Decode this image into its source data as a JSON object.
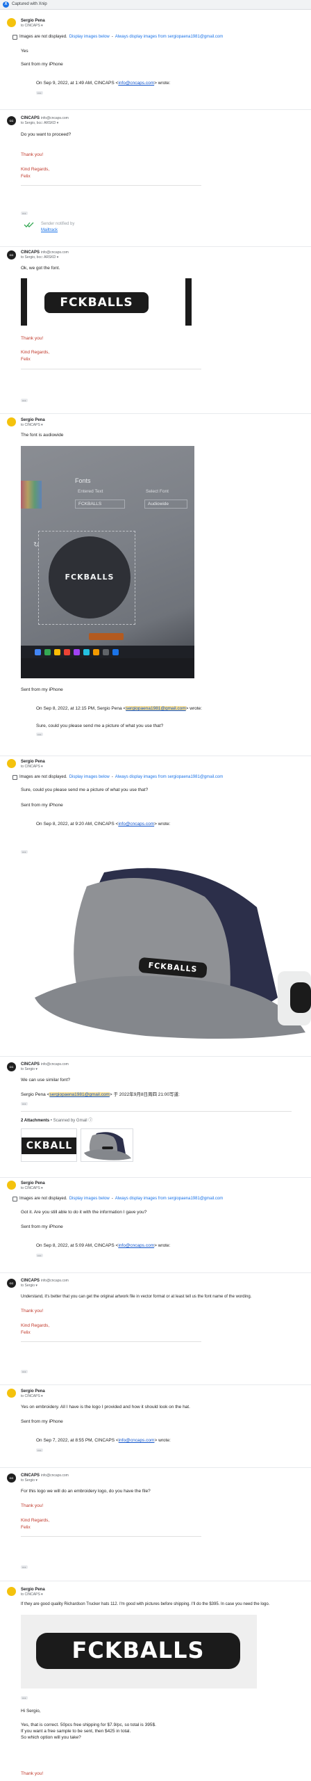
{
  "app": {
    "caption": "Captured with Xnip",
    "logo_letter": "X"
  },
  "msg1": {
    "from": "Sergio Pena",
    "to": "to CINCAPS ▾",
    "notice": "Images are not displayed.",
    "notice_link1": "Display images below",
    "notice_link2": "Always display images from sergiopaena1981@gmail.com",
    "line1": "Yes",
    "line2": "Sent from my iPhone",
    "quote_pre": "On Sep 9, 2022, at 1:49 AM, CINCAPS <",
    "quote_email": "info@cncaps.com",
    "quote_post": "> wrote:"
  },
  "msg2": {
    "from": "CINCAPS",
    "addr": "info@cncaps.com",
    "to": "to Sergio, bcc: ARSKD ▾",
    "line1": "Do you want to proceed?",
    "thanks": "Thank you!",
    "regards": "Kind Regards,",
    "name": "Felix",
    "verified_label": "Sender notified by",
    "verified_link": "Mailtrack"
  },
  "msg3": {
    "from": "CINCAPS",
    "addr": "info@cncaps.com",
    "to": "to Sergio, bcc: ARSKD ▾",
    "line1": "Ok, we got the font.",
    "logo_text": "FCKBALLS",
    "thanks": "Thank you!",
    "regards": "Kind Regards,",
    "name": "Felix"
  },
  "msg4": {
    "from": "Sergio Pena",
    "to": "to CINCAPS ▾",
    "line1": "The font is audiowide",
    "photo": {
      "panel_title": "Fonts",
      "entered_text_label": "Entered Text",
      "select_font_label": "Select Font",
      "entered_text": "FCKBALLS",
      "font_value": "Audiowide",
      "logo_text": "FCKBALLS"
    },
    "line2": "Sent from my iPhone",
    "quote_pre": "On Sep 8, 2022, at 12:15 PM, Sergio Pena <",
    "quote_email": "sergiopaena1981@gmail.com",
    "quote_post": "> wrote:",
    "quote_body": "Sure, could you please send me a picture of what you use that?"
  },
  "msg5": {
    "from": "Sergio Pena",
    "to": "to CINCAPS ▾",
    "notice": "Images are not displayed.",
    "notice_link1": "Display images below",
    "notice_link2": "Always display images from sergiopaena1981@gmail.com",
    "line1": "Sure, could you please send me a picture of what you use that?",
    "line2": "Sent from my iPhone",
    "quote_pre": "On Sep 8, 2022, at 9:20 AM, CINCAPS <",
    "quote_email": "info@cncaps.com",
    "quote_post": "> wrote:",
    "hat_logo": "FCKBALLS"
  },
  "msg6": {
    "from": "CINCAPS",
    "addr": "info@cncaps.com",
    "to": "to Sergio ▾",
    "line1": "We can use similar font?",
    "quote_pre": "Sergio Pena <",
    "quote_email": "sergiopaena1981@gmail.com",
    "quote_post": "> 于 2022年9月8日周四 21:00写道:",
    "attach_label": "2 Attachments",
    "attach_scan": "• Scanned by Gmail ⓘ",
    "attach1_text": "CKBALL"
  },
  "msg7": {
    "from": "Sergio Pena",
    "to": "to CINCAPS ▾",
    "notice": "Images are not displayed.",
    "notice_link1": "Display images below",
    "notice_link2": "Always display images from sergiopaena1981@gmail.com",
    "line1": "Got it. Are you still able to do it with the information I gave you?",
    "line2": "Sent from my iPhone",
    "quote_pre": "On Sep 8, 2022, at 5:09 AM, CINCAPS <",
    "quote_email": "info@cncaps.com",
    "quote_post": "> wrote:"
  },
  "msg8": {
    "from": "CINCAPS",
    "addr": "info@cncaps.com",
    "to": "to Sergio ▾",
    "line1": "Understand, it's better that you can get the original artwork file in vector format or at least tell us the font name of the wording.",
    "thanks": "Thank you!",
    "regards": "Kind Regards,",
    "name": "Felix"
  },
  "msg9": {
    "from": "Sergio Pena",
    "to": "to CINCAPS ▾",
    "line1": "Yes on embroidery. All I have is the logo I provided and how it should look on the hat.",
    "line2": "Sent from my iPhone",
    "quote_pre": "On Sep 7, 2022, at 8:55 PM, CINCAPS <",
    "quote_email": "info@cncaps.com",
    "quote_post": "> wrote:"
  },
  "msg10": {
    "from": "CINCAPS",
    "addr": "info@cncaps.com",
    "to": "to Sergio ▾",
    "line1": "For this logo we will do an embroidery logo, do you have the file?",
    "thanks": "Thank you!",
    "regards": "Kind Regards,",
    "name": "Felix"
  },
  "msg11": {
    "from": "Sergio Pena",
    "to": "to CINCAPS ▾",
    "line1": "If they are good quality Richardson Trucker hats 112. I'm good with pictures before shipping. I'll do the $395. In case you need the logo.",
    "logo_text": "FCKBALLS",
    "greet": "Hi Sergio,",
    "p1": "Yes, that is correct. 50pcs free shipping for $7.9/pc, so total is 395$.",
    "p2": "If you want a free sample to be sent, then $425 in total.",
    "p3": "So which option will you take?",
    "thanks": "Thank you!"
  },
  "colors": {
    "link": "#1155cc",
    "red_signature": "#c0392b",
    "highlight": "#fde293",
    "avatar_yellow": "#f4c20d"
  }
}
